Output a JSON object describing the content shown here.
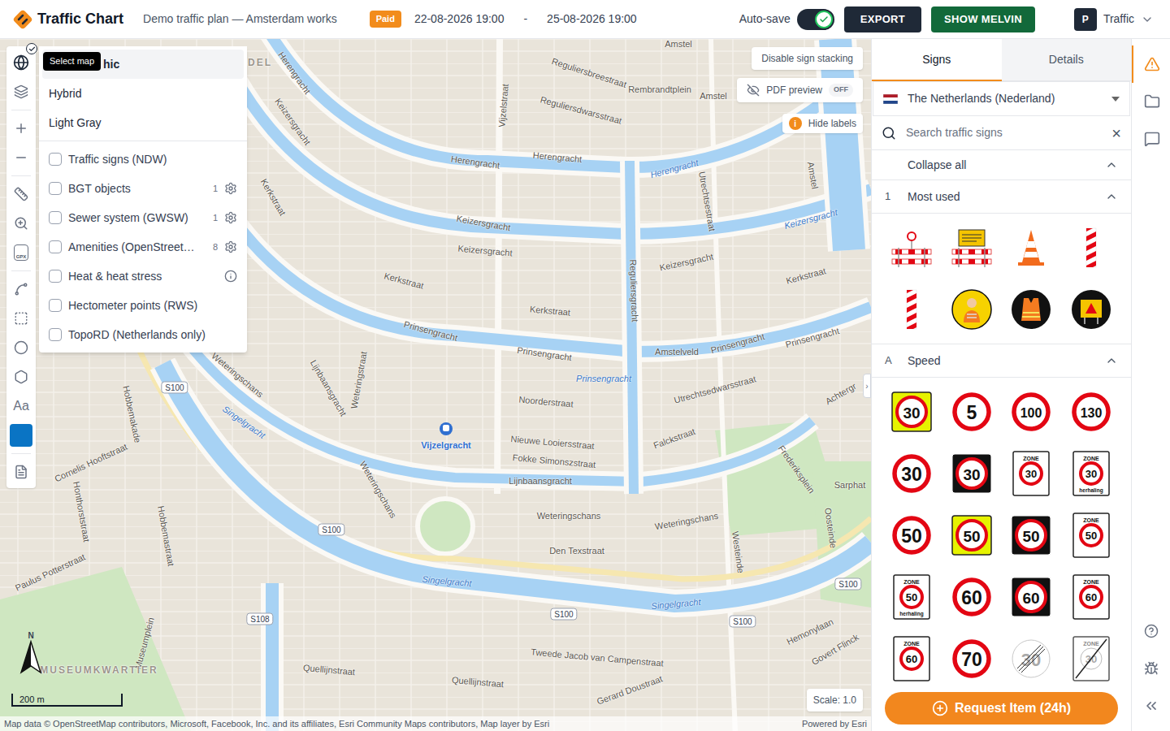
{
  "app": {
    "name": "Traffic Chart",
    "plan": "Demo traffic plan — Amsterdam works",
    "badge": "Paid",
    "start": "22-08-2026 19:00",
    "separator": "-",
    "end": "25-08-2026 19:00",
    "autosave": {
      "label": "Auto-save",
      "on": true
    },
    "export": "EXPORT",
    "melvin": "SHOW MELVIN",
    "user": {
      "initial": "P",
      "name": "Traffic"
    }
  },
  "toolbar": {
    "tooltip": "Select map",
    "map_active": true,
    "gpx": "GPX",
    "text_tool": "Aa",
    "color": "#0a74c4"
  },
  "layers": {
    "basemaps": [
      {
        "label": "hic",
        "selected": true
      },
      {
        "label": "Hybrid",
        "selected": false
      },
      {
        "label": "Light Gray",
        "selected": false
      }
    ],
    "overlays": [
      {
        "label": "Traffic signs (NDW)",
        "checked": false,
        "kind": "plain"
      },
      {
        "label": "BGT objects",
        "checked": false,
        "count": "1",
        "kind": "settings"
      },
      {
        "label": "Sewer system (GWSW)",
        "checked": false,
        "count": "1",
        "kind": "settings"
      },
      {
        "label": "Amenities (OpenStreet…",
        "checked": false,
        "count": "8",
        "kind": "settings"
      },
      {
        "label": "Heat & heat stress",
        "checked": false,
        "kind": "info"
      },
      {
        "label": "Hectometer points (RWS)",
        "checked": false,
        "kind": "plain"
      },
      {
        "label": "TopoRD (Netherlands only)",
        "checked": false,
        "kind": "plain"
      }
    ]
  },
  "map_controls": {
    "stacking": "Disable sign stacking",
    "pdf": {
      "label": "PDF preview",
      "state": "OFF",
      "on": false
    },
    "labels": {
      "icon": "i",
      "label": "Hide labels"
    },
    "scale": "Scale: 1.0",
    "scalebar": "200 m",
    "north": "N",
    "collapse": "›",
    "attribution": "Map data © OpenStreetMap contributors, Microsoft, Facebook, Inc. and its affiliates, Esri Community Maps contributors, Map layer by Esri",
    "powered": "Powered by Esri"
  },
  "map": {
    "labels": [
      {
        "text": "Amstel",
        "kind": "street"
      },
      {
        "text": "Reguliersbreestraat",
        "kind": "street"
      },
      {
        "text": "Rembrandtplein",
        "kind": "street"
      },
      {
        "text": "Amstel",
        "kind": "street"
      },
      {
        "text": "Herengracht",
        "kind": "street"
      },
      {
        "text": "Reguliersdwarsstraat",
        "kind": "street"
      },
      {
        "text": "Keizersgracht",
        "kind": "street"
      },
      {
        "text": "Vijzelstraat",
        "kind": "street"
      },
      {
        "text": "Herengracht",
        "kind": "street"
      },
      {
        "text": "Herengracht",
        "kind": "street"
      },
      {
        "text": "Herengracht",
        "kind": "water"
      },
      {
        "text": "Utrechtsestraat",
        "kind": "street"
      },
      {
        "text": "Amstel",
        "kind": "street"
      },
      {
        "text": "Keizersgracht",
        "kind": "water"
      },
      {
        "text": "Kerkstraat",
        "kind": "street"
      },
      {
        "text": "Keizersgracht",
        "kind": "street"
      },
      {
        "text": "Keizersgracht",
        "kind": "street"
      },
      {
        "text": "Keizersgracht",
        "kind": "street"
      },
      {
        "text": "Kerkstraat",
        "kind": "street"
      },
      {
        "text": "Kerkstraat",
        "kind": "street"
      },
      {
        "text": "Kerkstraat",
        "kind": "street"
      },
      {
        "text": "Reguliersgracht",
        "kind": "street"
      },
      {
        "text": "Prinsengracht",
        "kind": "street"
      },
      {
        "text": "Prinsengracht",
        "kind": "street"
      },
      {
        "text": "Prinsengracht",
        "kind": "water"
      },
      {
        "text": "Amstelveld",
        "kind": "street"
      },
      {
        "text": "Prinsengracht",
        "kind": "street"
      },
      {
        "text": "Prinsengracht",
        "kind": "street"
      },
      {
        "text": "Weteringschans",
        "kind": "street"
      },
      {
        "text": "Lijnbaansgracht",
        "kind": "street"
      },
      {
        "text": "Weteringstraat",
        "kind": "street"
      },
      {
        "text": "Singelgracht",
        "kind": "water"
      },
      {
        "text": "Noorderstraat",
        "kind": "street"
      },
      {
        "text": "Utrechtsedwarsstraat",
        "kind": "street"
      },
      {
        "text": "Achtergr",
        "kind": "street"
      },
      {
        "text": "Vijzelgracht",
        "kind": "station"
      },
      {
        "text": "Nieuwe Looiersstraat",
        "kind": "street"
      },
      {
        "text": "Falckstraat",
        "kind": "street"
      },
      {
        "text": "Fokke Simonszstraat",
        "kind": "street"
      },
      {
        "text": "Lijnbaansgracht",
        "kind": "street"
      },
      {
        "text": "Hobbemakade",
        "kind": "street"
      },
      {
        "text": "Cornelis Hooftstraat",
        "kind": "street"
      },
      {
        "text": "Weteringschans",
        "kind": "street"
      },
      {
        "text": "Frederiksplein",
        "kind": "street"
      },
      {
        "text": "Sarphat",
        "kind": "street"
      },
      {
        "text": "Honthorststraat",
        "kind": "street"
      },
      {
        "text": "Weteringschans",
        "kind": "street"
      },
      {
        "text": "Weteringschans",
        "kind": "street"
      },
      {
        "text": "Hobbemastraat",
        "kind": "street"
      },
      {
        "text": "Westeinde",
        "kind": "street"
      },
      {
        "text": "Oosteinde",
        "kind": "street"
      },
      {
        "text": "Den Texstraat",
        "kind": "street"
      },
      {
        "text": "Paulus Potterstraat",
        "kind": "street"
      },
      {
        "text": "Singelgracht",
        "kind": "water"
      },
      {
        "text": "Singelgracht",
        "kind": "water"
      },
      {
        "text": "Hemonylaan",
        "kind": "street"
      },
      {
        "text": "Tweede Jacob van Campenstraat",
        "kind": "street"
      },
      {
        "text": "Museumplein",
        "kind": "street"
      },
      {
        "text": "Quellijnstraat",
        "kind": "street"
      },
      {
        "text": "Quellijnstraat",
        "kind": "street"
      },
      {
        "text": "Gerard Doustraat",
        "kind": "street"
      },
      {
        "text": "Govert Flinck",
        "kind": "street"
      },
      {
        "text": "MUSEUMKWARTIER",
        "kind": "district"
      },
      {
        "text": "DEL",
        "kind": "district"
      }
    ],
    "shields": [
      "S100",
      "S100",
      "S100",
      "S100",
      "S100",
      "S108"
    ]
  },
  "panel": {
    "tabs": [
      {
        "label": "Signs",
        "selected": true
      },
      {
        "label": "Details",
        "selected": false
      }
    ],
    "country": "The Netherlands (Nederland)",
    "search": {
      "placeholder": "Search traffic signs",
      "clear": "×"
    },
    "collapse": "Collapse all",
    "sections": [
      {
        "code": "1",
        "title": "Most used",
        "expanded": true,
        "items": [
          {
            "kind": "barrier-lamp"
          },
          {
            "kind": "barrier-sign"
          },
          {
            "kind": "cone"
          },
          {
            "kind": "beacon"
          },
          {
            "kind": "beacon"
          },
          {
            "kind": "worker"
          },
          {
            "kind": "vest"
          },
          {
            "kind": "sign-alert"
          }
        ]
      },
      {
        "code": "A",
        "title": "Speed",
        "expanded": true,
        "items": [
          {
            "kind": "round-yellow",
            "number": "30"
          },
          {
            "kind": "round",
            "number": "5"
          },
          {
            "kind": "round",
            "number": "100"
          },
          {
            "kind": "round",
            "number": "130"
          },
          {
            "kind": "round",
            "number": "30"
          },
          {
            "kind": "round-black",
            "number": "30"
          },
          {
            "kind": "zone",
            "top": "ZONE",
            "number": "30"
          },
          {
            "kind": "zone",
            "top": "ZONE",
            "number": "30",
            "bottom": "herhaling"
          },
          {
            "kind": "round",
            "number": "50"
          },
          {
            "kind": "round-yellow",
            "number": "50"
          },
          {
            "kind": "round-black",
            "number": "50"
          },
          {
            "kind": "zone",
            "top": "ZONE",
            "number": "50"
          },
          {
            "kind": "zone",
            "top": "ZONE",
            "number": "50",
            "bottom": "herhaling"
          },
          {
            "kind": "round",
            "number": "60"
          },
          {
            "kind": "round-black",
            "number": "60"
          },
          {
            "kind": "zone",
            "top": "ZONE",
            "number": "60"
          },
          {
            "kind": "zone",
            "top": "ZONE",
            "number": "60"
          },
          {
            "kind": "round",
            "number": "70"
          },
          {
            "kind": "end",
            "number": "30"
          },
          {
            "kind": "zone-end",
            "top": "ZONE",
            "number": "30"
          }
        ]
      }
    ],
    "request": "Request Item (24h)"
  },
  "rail": {
    "items": [
      {
        "selected": true
      },
      {
        "selected": false
      },
      {
        "selected": false
      }
    ]
  }
}
